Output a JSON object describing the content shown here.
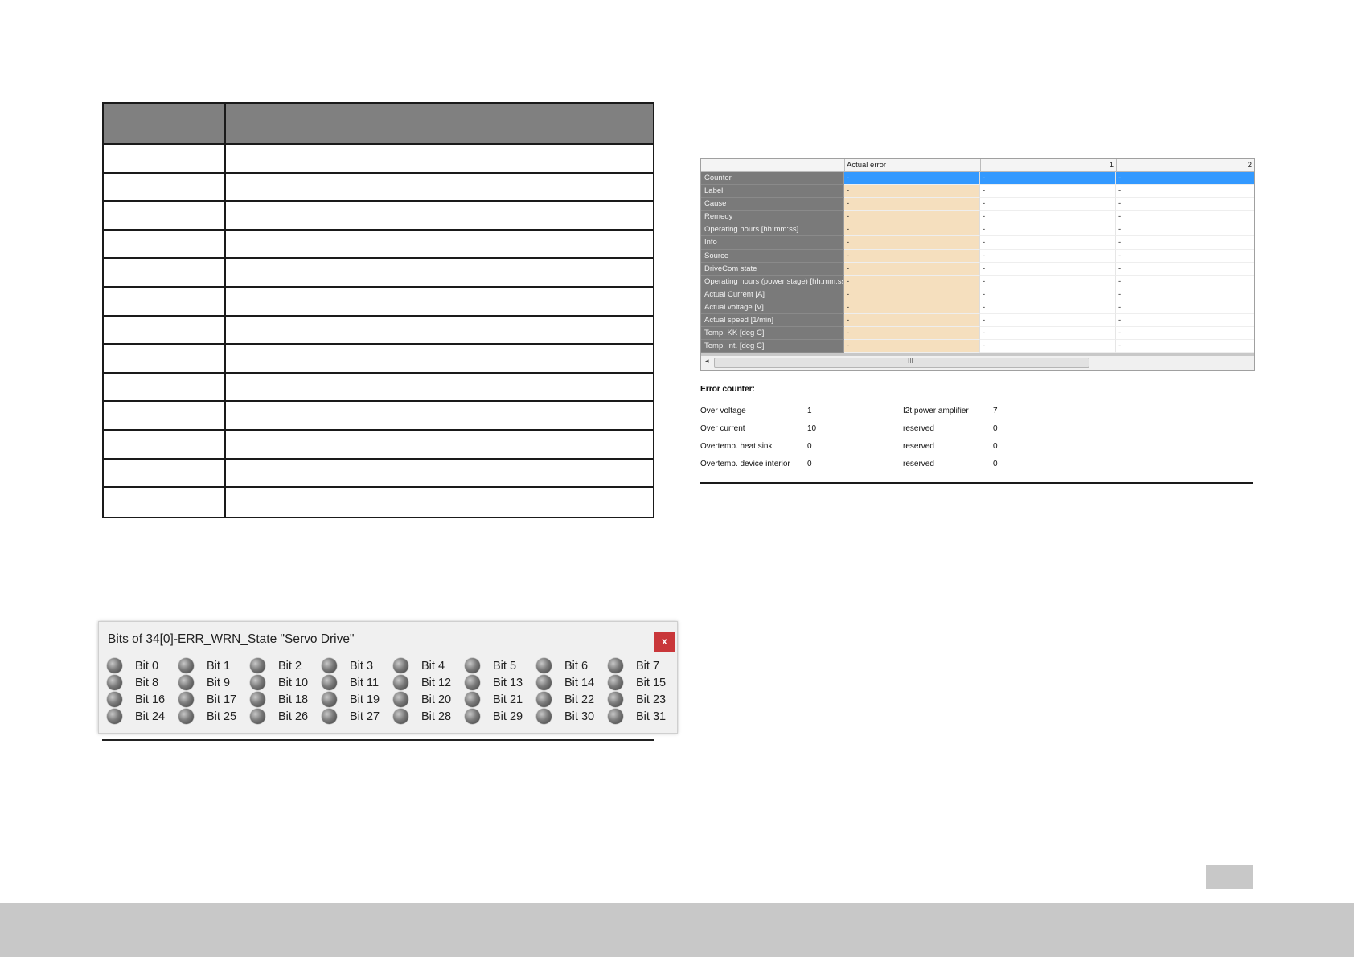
{
  "grid": {
    "headers": [
      "Actual error",
      "1",
      "2"
    ],
    "rows": [
      {
        "label": "Counter",
        "values": [
          "-",
          "-",
          "-"
        ]
      },
      {
        "label": "Label",
        "values": [
          "-",
          "-",
          "-"
        ]
      },
      {
        "label": "Cause",
        "values": [
          "-",
          "-",
          "-"
        ]
      },
      {
        "label": "Remedy",
        "values": [
          "-",
          "-",
          "-"
        ]
      },
      {
        "label": "Operating hours [hh:mm:ss]",
        "values": [
          "-",
          "-",
          "-"
        ]
      },
      {
        "label": "Info",
        "values": [
          "-",
          "-",
          "-"
        ]
      },
      {
        "label": "Source",
        "values": [
          "-",
          "-",
          "-"
        ]
      },
      {
        "label": "DriveCom state",
        "values": [
          "-",
          "-",
          "-"
        ]
      },
      {
        "label": "Operating hours (power stage) [hh:mm:ss]",
        "values": [
          "-",
          "-",
          "-"
        ]
      },
      {
        "label": "Actual Current  [A]",
        "values": [
          "-",
          "-",
          "-"
        ]
      },
      {
        "label": "Actual voltage  [V]",
        "values": [
          "-",
          "-",
          "-"
        ]
      },
      {
        "label": "Actual speed  [1/min]",
        "values": [
          "-",
          "-",
          "-"
        ]
      },
      {
        "label": "Temp. KK  [deg C]",
        "values": [
          "-",
          "-",
          "-"
        ]
      },
      {
        "label": "Temp. int.  [deg C]",
        "values": [
          "-",
          "-",
          "-"
        ]
      }
    ],
    "selected_row": "Counter",
    "scroll_grip": "III",
    "scroll_left": "◂"
  },
  "error_counter": {
    "title": "Error counter:",
    "items": [
      {
        "label": "Over voltage",
        "value": "1"
      },
      {
        "label": "Over current",
        "value": "10"
      },
      {
        "label": "Overtemp. heat sink",
        "value": "0"
      },
      {
        "label": "Overtemp. device interior",
        "value": "0"
      },
      {
        "label": "I2t power amplifier",
        "value": "7"
      },
      {
        "label": "reserved",
        "value": "0"
      },
      {
        "label": "reserved",
        "value": "0"
      },
      {
        "label": "reserved",
        "value": "0"
      }
    ]
  },
  "bits_window": {
    "title": "Bits of 34[0]-ERR_WRN_State \"Servo Drive\"",
    "close": "x",
    "bits": [
      "Bit 0",
      "Bit 1",
      "Bit 2",
      "Bit 3",
      "Bit 4",
      "Bit 5",
      "Bit 6",
      "Bit 7",
      "Bit 8",
      "Bit 9",
      "Bit 10",
      "Bit 11",
      "Bit 12",
      "Bit 13",
      "Bit 14",
      "Bit 15",
      "Bit 16",
      "Bit 17",
      "Bit 18",
      "Bit 19",
      "Bit 20",
      "Bit 21",
      "Bit 22",
      "Bit 23",
      "Bit 24",
      "Bit 25",
      "Bit 26",
      "Bit 27",
      "Bit 28",
      "Bit 29",
      "Bit 30",
      "Bit 31"
    ]
  },
  "colors": {
    "header_gray": "#808080",
    "actual_error_col": "#f5dfbe",
    "selection": "#3399ff",
    "close_button": "#c9373a",
    "footer": "#c8c8c8"
  }
}
